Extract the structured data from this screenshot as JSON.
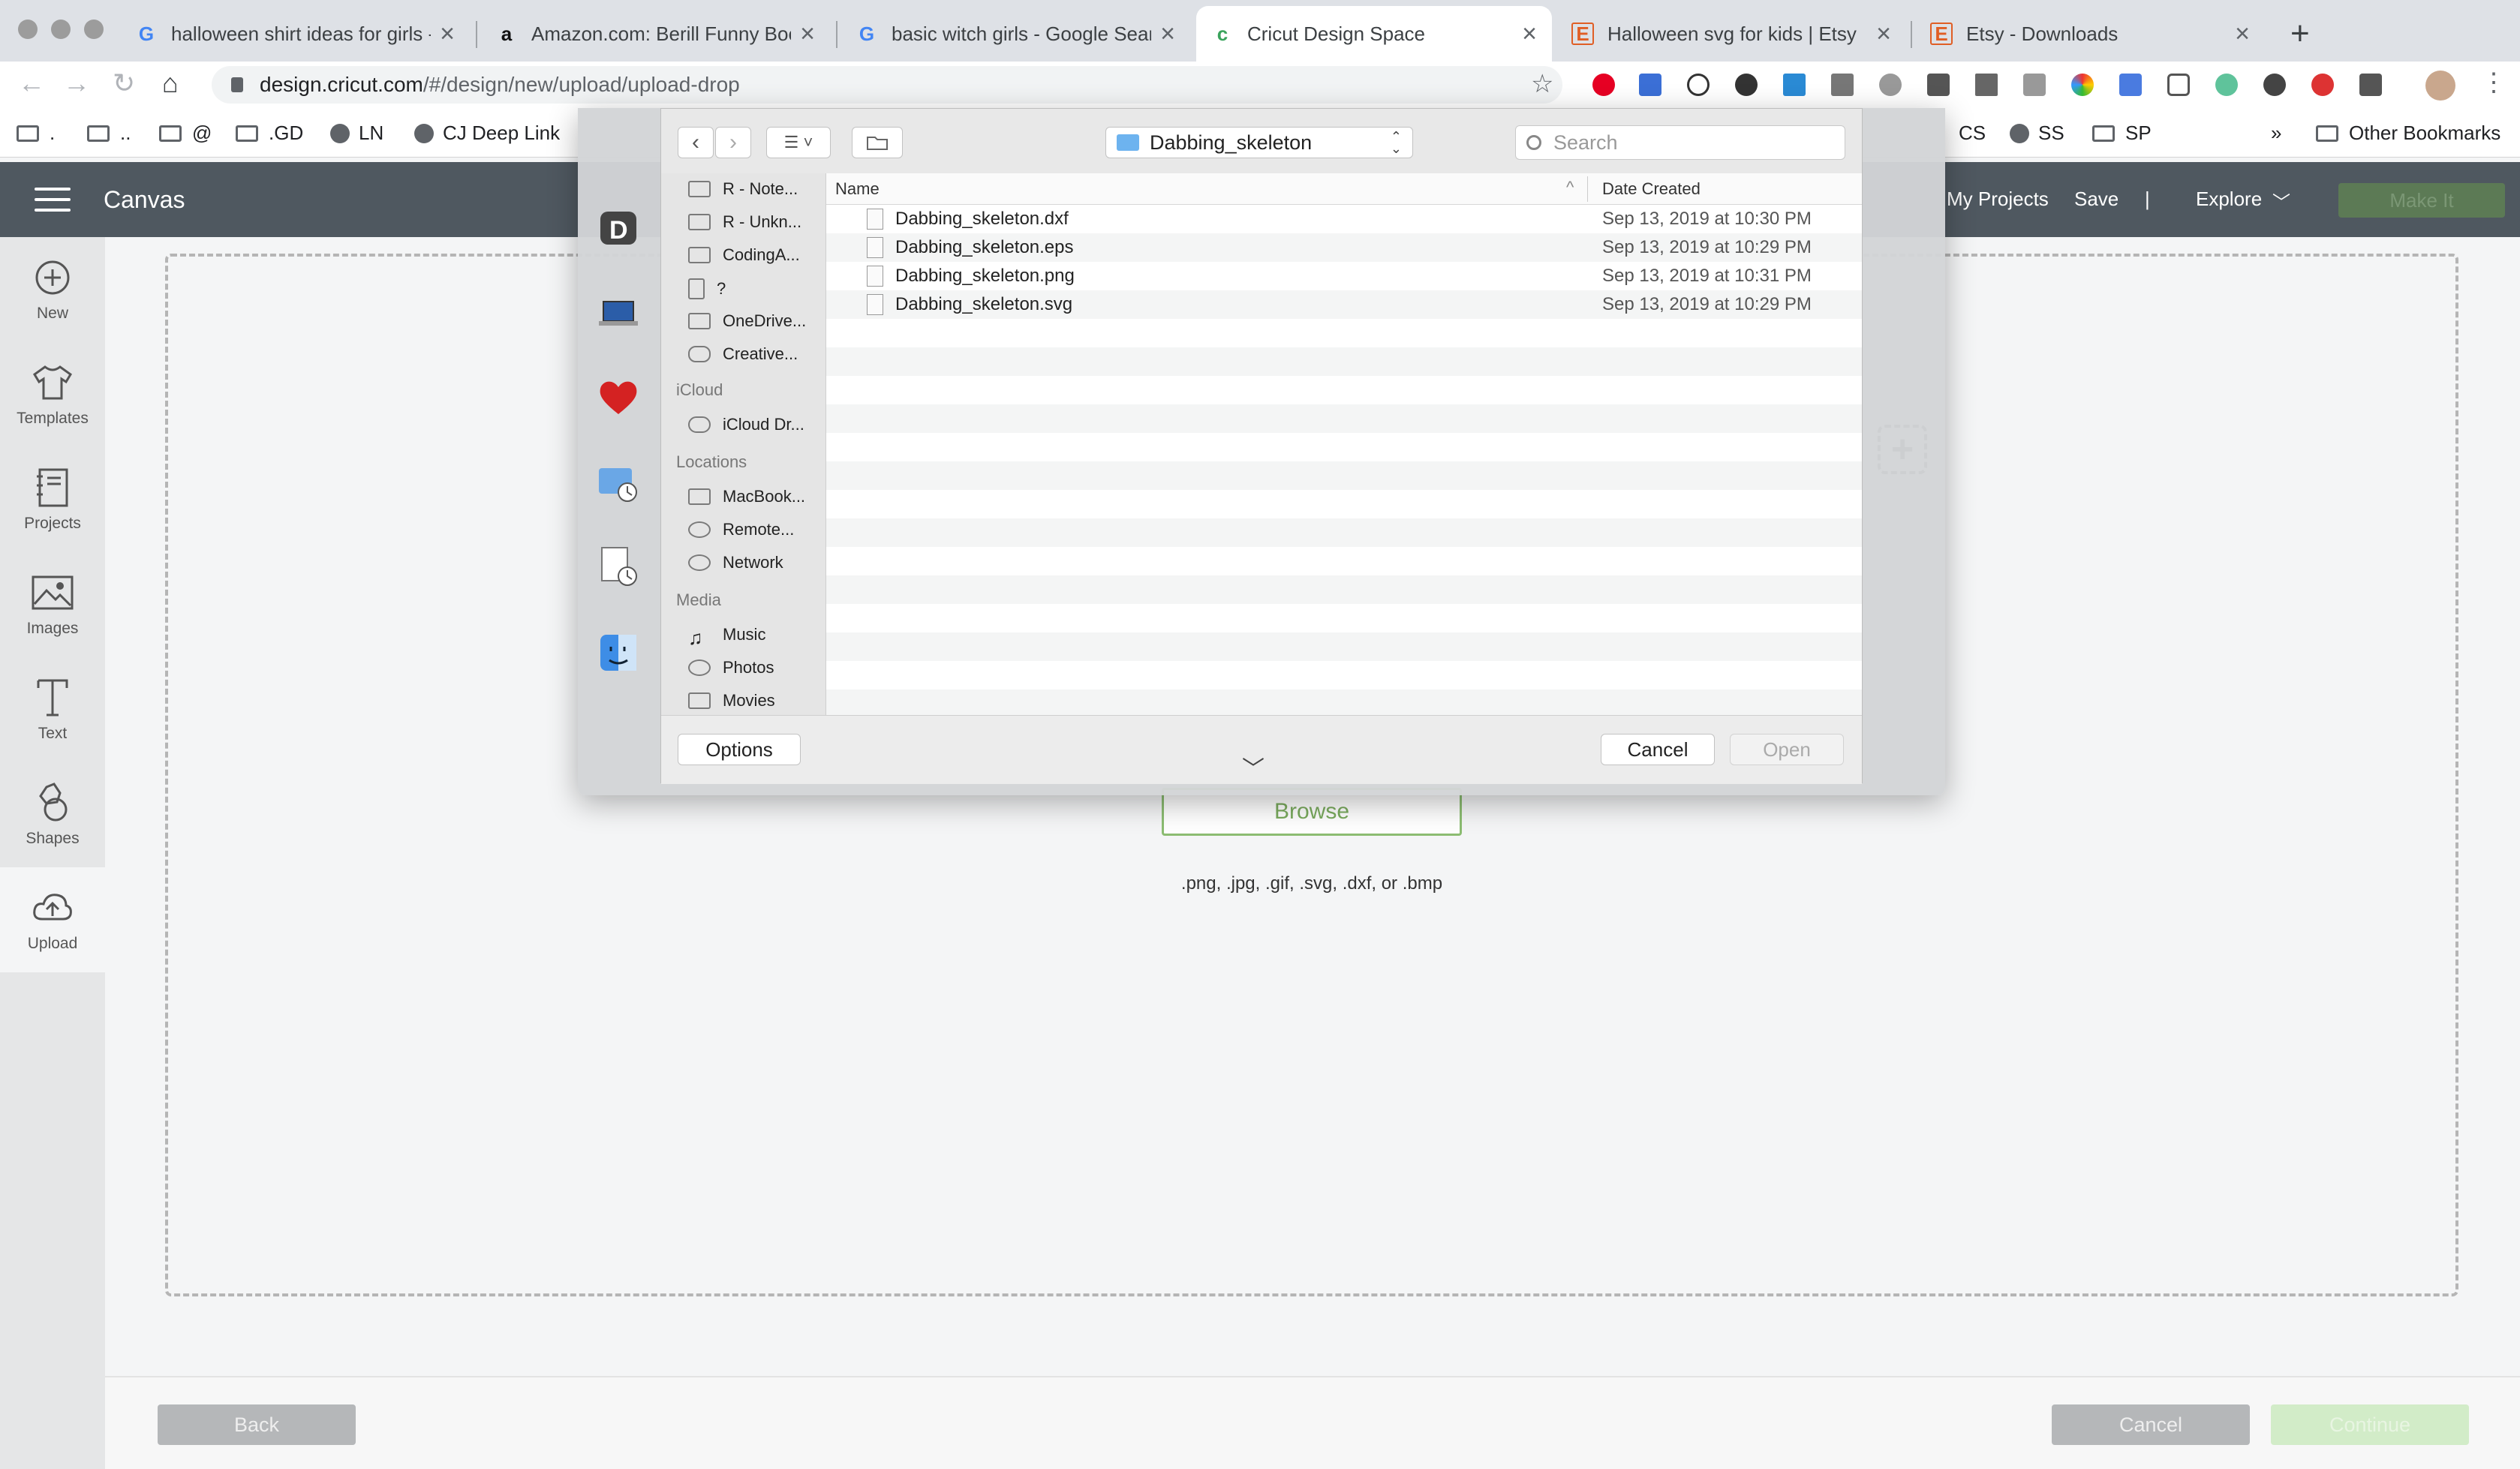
{
  "browser": {
    "tabs": [
      {
        "title": "halloween shirt ideas for girls -",
        "icon": "google-icon"
      },
      {
        "title": "Amazon.com: Berill Funny Boo",
        "icon": "amazon-icon"
      },
      {
        "title": "basic witch girls - Google Sear",
        "icon": "google-icon"
      },
      {
        "title": "Cricut Design Space",
        "icon": "cricut-icon"
      },
      {
        "title": "Halloween svg for kids | Etsy",
        "icon": "etsy-icon"
      },
      {
        "title": "Etsy - Downloads",
        "icon": "etsy-icon"
      }
    ],
    "url_domain": "design.cricut.com",
    "url_path": "/#/design/new/upload/upload-drop",
    "bookmarks": [
      ".",
      "..",
      "@",
      ".GD",
      "LN",
      "CJ Deep Link",
      "CS",
      "SS",
      "SP"
    ],
    "bookmarks_more": "»",
    "other_bookmarks": "Other Bookmarks"
  },
  "app": {
    "title": "Canvas",
    "nav": {
      "my_projects": "My Projects",
      "save": "Save",
      "divider": "|",
      "explore": "Explore",
      "make_it": "Make It"
    },
    "sidebar": [
      {
        "label": "New",
        "icon": "plus-circle-icon"
      },
      {
        "label": "Templates",
        "icon": "tshirt-icon"
      },
      {
        "label": "Projects",
        "icon": "notebook-icon"
      },
      {
        "label": "Images",
        "icon": "image-icon"
      },
      {
        "label": "Text",
        "icon": "text-icon"
      },
      {
        "label": "Shapes",
        "icon": "shapes-icon"
      },
      {
        "label": "Upload",
        "icon": "cloud-upload-icon"
      }
    ],
    "browse_label": "Browse",
    "formats": ".png, .jpg, .gif, .svg, .dxf, or .bmp",
    "footer": {
      "back": "Back",
      "cancel": "Cancel",
      "continue": "Continue"
    }
  },
  "dialog": {
    "folder": "Dabbing_skeleton",
    "search_placeholder": "Search",
    "favorites": [
      "R - Note...",
      "R - Unkn...",
      "CodingA...",
      "?",
      "OneDrive...",
      "Creative..."
    ],
    "icloud_head": "iCloud",
    "icloud": [
      "iCloud Dr..."
    ],
    "locations_head": "Locations",
    "locations": [
      "MacBook...",
      "Remote...",
      "Network"
    ],
    "media_head": "Media",
    "media": [
      "Music",
      "Photos",
      "Movies"
    ],
    "columns": {
      "name": "Name",
      "date": "Date Created"
    },
    "files": [
      {
        "name": "Dabbing_skeleton.dxf",
        "date": "Sep 13, 2019 at 10:30 PM"
      },
      {
        "name": "Dabbing_skeleton.eps",
        "date": "Sep 13, 2019 at 10:29 PM"
      },
      {
        "name": "Dabbing_skeleton.png",
        "date": "Sep 13, 2019 at 10:31 PM"
      },
      {
        "name": "Dabbing_skeleton.svg",
        "date": "Sep 13, 2019 at 10:29 PM"
      }
    ],
    "options": "Options",
    "cancel": "Cancel",
    "open": "Open"
  }
}
